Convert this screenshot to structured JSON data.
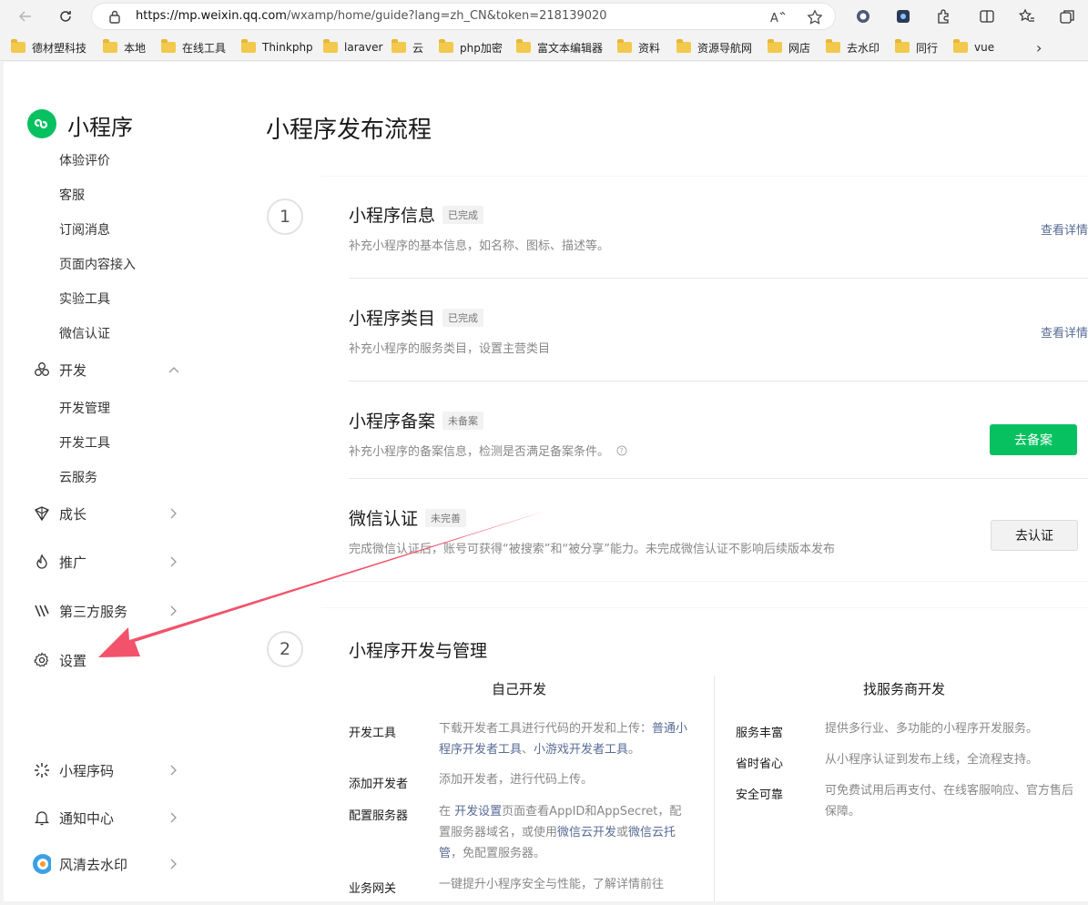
{
  "browser": {
    "url_host": "https://mp.weixin.qq.com",
    "url_path": "/wxamp/home/guide?lang=zh_CN&token=218139020",
    "bookmarks": [
      "德材塑科技",
      "本地",
      "在线工具",
      "Thinkphp",
      "laraver",
      "云",
      "php加密",
      "富文本编辑器",
      "资料",
      "资源导航网",
      "网店",
      "去水印",
      "同行",
      "vue"
    ]
  },
  "sidebar": {
    "brand": "小程序",
    "top_items": [
      "体验评价",
      "客服",
      "订阅消息",
      "页面内容接入",
      "实验工具",
      "微信认证"
    ],
    "dev_group": {
      "label": "开发",
      "items": [
        "开发管理",
        "开发工具",
        "云服务"
      ]
    },
    "growth": "成长",
    "promotion": "推广",
    "third_party": "第三方服务",
    "settings": "设置",
    "bottom": {
      "qrcode": "小程序码",
      "notify": "通知中心",
      "account": "风清去水印"
    }
  },
  "main": {
    "title": "小程序发布流程",
    "step1": {
      "number": "1",
      "rows": [
        {
          "title": "小程序信息",
          "badge": "已完成",
          "desc": "补充小程序的基本信息，如名称、图标、描述等。",
          "action": "查看详情"
        },
        {
          "title": "小程序类目",
          "badge": "已完成",
          "desc": "补充小程序的服务类目，设置主营类目",
          "action": "查看详情"
        },
        {
          "title": "小程序备案",
          "badge": "未备案",
          "desc": "补充小程序的备案信息，检测是否满足备案条件。",
          "action": "去备案"
        },
        {
          "title": "微信认证",
          "badge": "未完善",
          "desc": "完成微信认证后，账号可获得“被搜索”和“被分享”能力。未完成微信认证不影响后续版本发布",
          "action": "去认证"
        }
      ]
    },
    "step2": {
      "number": "2",
      "title": "小程序开发与管理",
      "left": {
        "header": "自己开发",
        "tools_label": "开发工具",
        "tools_desc_prefix": "下载开发者工具进行代码的开发和上传：",
        "tools_link1": "普通小程序开发者工具",
        "tools_sep": "、",
        "tools_link2": "小游戏开发者工具",
        "tools_end": "。",
        "add_label": "添加开发者",
        "add_desc": "添加开发者，进行代码上传。",
        "server_label": "配置服务器",
        "server_desc_prefix": "在",
        "server_link1": "开发设置",
        "server_desc_mid": "页面查看AppID和AppSecret，配置服务器域名，或使用",
        "server_link2": "微信云开发",
        "server_or": "或",
        "server_link3": "微信云托管",
        "server_desc_end": "，免配置服务器。",
        "gateway_label": "业务网关",
        "gateway_desc": "一键提升小程序安全与性能，了解详情前往"
      },
      "right": {
        "header": "找服务商开发",
        "items": [
          {
            "label": "服务丰富",
            "desc": "提供多行业、多功能的小程序开发服务。"
          },
          {
            "label": "省时省心",
            "desc": "从小程序认证到发布上线，全流程支持。"
          },
          {
            "label": "安全可靠",
            "desc": "可免费试用后再支付、在线客服响应、官方售后保障。"
          }
        ]
      }
    }
  },
  "colors": {
    "brand_green": "#07c160",
    "link_blue": "#576b95",
    "annotation_arrow": "#f2536b"
  }
}
